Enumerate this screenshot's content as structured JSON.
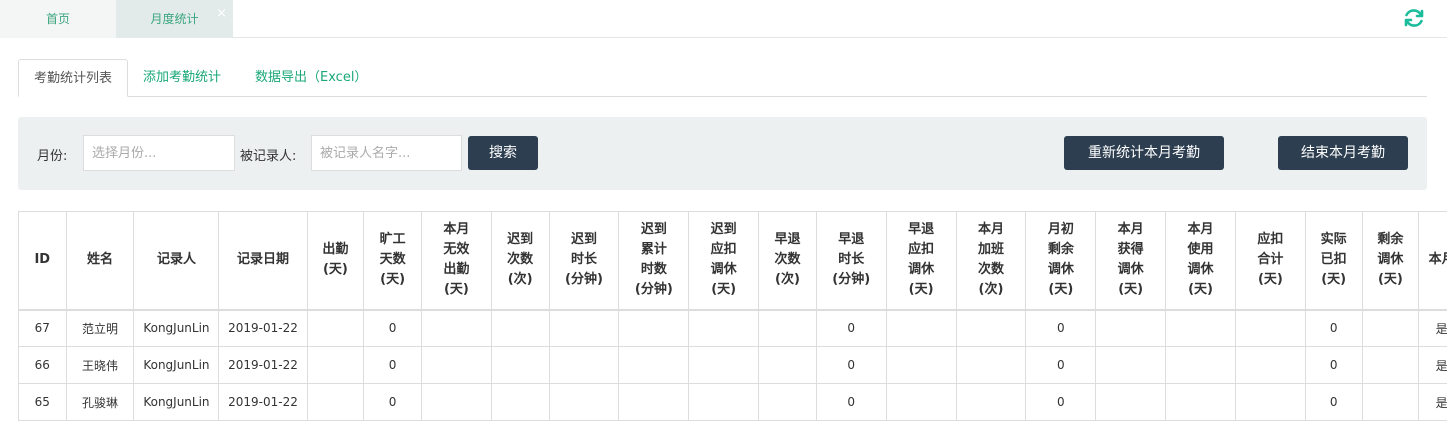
{
  "top_tabs": [
    {
      "label": "首页"
    },
    {
      "label": "月度统计",
      "close": "×"
    }
  ],
  "refresh_icon": "refresh-icon",
  "sub_tabs": [
    {
      "label": "考勤统计列表"
    },
    {
      "label": "添加考勤统计"
    },
    {
      "label": "数据导出（Excel）"
    }
  ],
  "search": {
    "month_label": "月份:",
    "month_placeholder": "选择月份...",
    "person_label": "被记录人:",
    "person_placeholder": "被记录人名字...",
    "search_button": "搜索",
    "recount_button": "重新统计本月考勤",
    "finish_button": "结束本月考勤"
  },
  "table": {
    "columns": [
      {
        "lines": [
          "ID"
        ]
      },
      {
        "lines": [
          "姓名"
        ]
      },
      {
        "lines": [
          "记录人"
        ]
      },
      {
        "lines": [
          "记录日期"
        ]
      },
      {
        "lines": [
          "出勤",
          "(天)"
        ]
      },
      {
        "lines": [
          "旷工",
          "天数",
          "(天)"
        ]
      },
      {
        "lines": [
          "本月",
          "无效",
          "出勤",
          "(天)"
        ]
      },
      {
        "lines": [
          "迟到",
          "次数",
          "(次)"
        ]
      },
      {
        "lines": [
          "迟到",
          "时长",
          "(分钟)"
        ]
      },
      {
        "lines": [
          "迟到",
          "累计",
          "时数",
          "(分钟)"
        ]
      },
      {
        "lines": [
          "迟到",
          "应扣",
          "调休",
          "(天)"
        ]
      },
      {
        "lines": [
          "早退",
          "次数",
          "(次)"
        ]
      },
      {
        "lines": [
          "早退",
          "时长",
          "(分钟)"
        ]
      },
      {
        "lines": [
          "早退",
          "应扣",
          "调休",
          "(天)"
        ]
      },
      {
        "lines": [
          "本月",
          "加班",
          "次数",
          "(次)"
        ]
      },
      {
        "lines": [
          "月初",
          "剩余",
          "调休",
          "(天)"
        ]
      },
      {
        "lines": [
          "本月",
          "获得",
          "调休",
          "(天)"
        ]
      },
      {
        "lines": [
          "本月",
          "使用",
          "调休",
          "(天)"
        ]
      },
      {
        "lines": [
          "应扣",
          "合计",
          "(天)"
        ]
      },
      {
        "lines": [
          "实际",
          "已扣",
          "(天)"
        ]
      },
      {
        "lines": [
          "剩余",
          "调休",
          "(天)"
        ]
      },
      {
        "lines": [
          "本月"
        ]
      }
    ],
    "rows": [
      [
        "67",
        "范立明",
        "KongJunLin",
        "2019-01-22",
        "",
        "0",
        "",
        "",
        "",
        "",
        "",
        "",
        "0",
        "",
        "",
        "0",
        "",
        "",
        "",
        "0",
        "",
        "是"
      ],
      [
        "66",
        "王晓伟",
        "KongJunLin",
        "2019-01-22",
        "",
        "0",
        "",
        "",
        "",
        "",
        "",
        "",
        "0",
        "",
        "",
        "0",
        "",
        "",
        "",
        "0",
        "",
        "是"
      ],
      [
        "65",
        "孔骏琳",
        "KongJunLin",
        "2019-01-22",
        "",
        "0",
        "",
        "",
        "",
        "",
        "",
        "",
        "0",
        "",
        "",
        "0",
        "",
        "",
        "",
        "0",
        "",
        "是"
      ]
    ]
  },
  "colors": {
    "accent": "#1aa879",
    "button_dark": "#2c3e50",
    "panel_bg": "#ecf0f1",
    "active_tab_bg": "#e2ebea"
  }
}
